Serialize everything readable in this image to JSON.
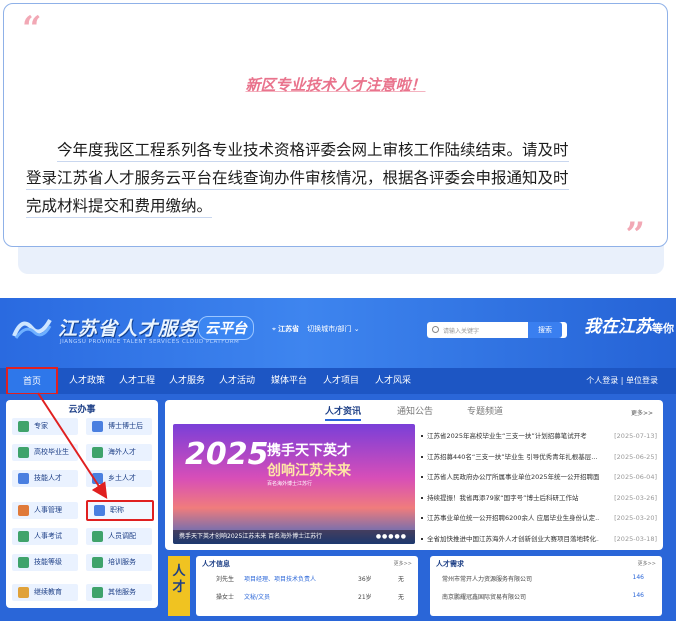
{
  "notice": {
    "title": "新区专业技术人才注意啦！",
    "line1": "今年度我区工程系列各专业技术资格评委会网上审核工作陆续结束。请及时",
    "line2": "登录江苏省人才服务云平台在线查询办件审核情况，根据各评委会申报通知及时",
    "line3": "完成材料提交和费用缴纳。",
    "quote_open": "“",
    "quote_close": "”"
  },
  "site": {
    "name": "江苏省人才服务",
    "name_en": "JIANGSU PROVINCE TALENT SERVICES CLOUD PLATFORM",
    "cloud": "云平台",
    "city": "江苏省",
    "switch_city": "切换城市/部门",
    "search_placeholder": "请输入关键字",
    "search_btn": "搜索",
    "slogan_a": "我在",
    "slogan_b": "江苏",
    "slogan_c": "等你",
    "nav": [
      "首页",
      "人才政策",
      "人才工程",
      "人才服务",
      "人才活动",
      "媒体平台",
      "人才项目",
      "人才风采"
    ],
    "nav_right": "个人登录 | 单位登录",
    "panel_title": "云办事",
    "services": [
      "专家",
      "博士博士后",
      "高校毕业生",
      "海外人才",
      "技能人才",
      "乡土人才",
      "人事管理",
      "职称",
      "人事考试",
      "人员调配",
      "技能等级",
      "培训服务",
      "继续教育",
      "其他服务"
    ],
    "news_tabs": [
      "人才资讯",
      "通知公告",
      "专题频道"
    ],
    "news_more": "更多>>",
    "banner": {
      "year": "2025",
      "t1": "携手天下英才",
      "t2": "创响江苏未来",
      "t3": "百名海外博士江苏行",
      "caption": "携手天下英才创响2025江苏未来 百名海外博士江苏行",
      "dots": "●●●●●"
    },
    "news": [
      {
        "t": "江苏省2025年高校毕业生“三支一扶”计划招募笔试开考",
        "d": "[2025-07-13]"
      },
      {
        "t": "江苏招募440名“三支一扶”毕业生 引导优秀青年扎根基层...",
        "d": "[2025-06-25]"
      },
      {
        "t": "江苏省人民政府办公厅所属事业单位2025年统一公开招聘面...",
        "d": "[2025-06-04]"
      },
      {
        "t": "持续提振！我省再添79家“国字号”博士后科研工作站",
        "d": "[2025-03-26]"
      },
      {
        "t": "江苏事业单位统一公开招聘6200余人 应届毕业生身份认定...",
        "d": "[2025-03-20]"
      },
      {
        "t": "全省加快推进中国江苏海外人才创新创业大赛项目落地转化...",
        "d": "[2025-03-18]"
      }
    ],
    "side_label": "人才",
    "info_left": {
      "head": "人才信息",
      "more": "更多>>",
      "rows": [
        {
          "name": "刘先生",
          "tag": "项目经理、项目技术负责人",
          "age": "36岁",
          "x": "无"
        },
        {
          "name": "操女士",
          "tag": "文秘/文员",
          "age": "21岁",
          "x": "无"
        }
      ]
    },
    "info_right": {
      "head": "人才需求",
      "more": "更多>>",
      "rows": [
        {
          "name": "常州市常开人力资源服务有限公司",
          "n": "146"
        },
        {
          "name": "南京鹏耀冠鑫国际贸易有限公司",
          "n": "146"
        }
      ]
    }
  }
}
